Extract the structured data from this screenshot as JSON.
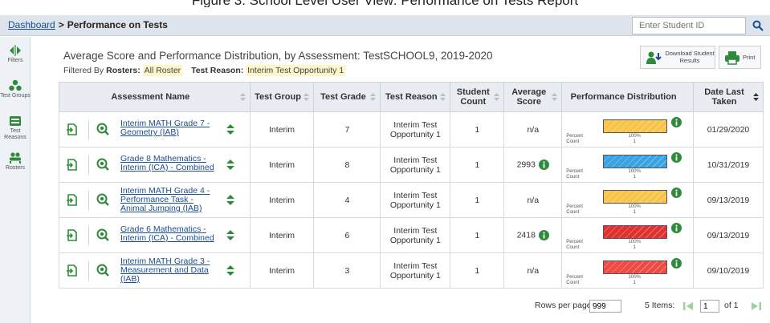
{
  "caption": "Figure 3. School Level User View: Performance on Tests Report",
  "breadcrumb": {
    "home": "Dashboard",
    "separator": ">",
    "current": "Performance on Tests"
  },
  "student_search": {
    "placeholder": "Enter Student ID",
    "icon": "search-icon"
  },
  "left_nav": [
    {
      "label": "Filters",
      "icon": "filters-icon"
    },
    {
      "label": "Test Groups",
      "icon": "test-groups-icon"
    },
    {
      "label": "Test Reasons",
      "icon": "test-reasons-icon"
    },
    {
      "label": "Rosters",
      "icon": "rosters-icon"
    }
  ],
  "panel": {
    "title": "Average Score and Performance Distribution, by Assessment: TestSCHOOL9, 2019-2020",
    "filter_prefix": "Filtered By",
    "rosters_label": "Rosters:",
    "rosters_value": "All Roster",
    "reason_label": "Test Reason:",
    "reason_value": "Interim Test Opportunity 1"
  },
  "actions": {
    "download": "Download Student Results",
    "print": "Print"
  },
  "table": {
    "headers": [
      "Assessment Name",
      "Test Group",
      "Test Grade",
      "Test Reason",
      "Student Count",
      "Average Score",
      "Performance Distribution",
      "Date Last Taken"
    ],
    "perf_labels": {
      "percent": "Percent",
      "count": "Count"
    },
    "rows": [
      {
        "name": "Interim MATH Grade 7 - Geometry (IAB)",
        "group": "Interim",
        "grade": "7",
        "reason": "Interim Test Opportunity 1",
        "count": "1",
        "score": "n/a",
        "score_info": false,
        "percent": "100%",
        "pcount": "1",
        "bar_color": "#f7c448",
        "date": "01/29/2020"
      },
      {
        "name": "Grade 8 Mathematics - Interim (ICA) - Combined",
        "group": "Interim",
        "grade": "8",
        "reason": "Interim Test Opportunity 1",
        "count": "1",
        "score": "2993",
        "score_info": true,
        "percent": "100%",
        "pcount": "1",
        "bar_color": "#3aa3e3",
        "date": "10/31/2019"
      },
      {
        "name": "Interim MATH Grade 4 - Performance Task - Animal Jumping (IAB)",
        "group": "Interim",
        "grade": "4",
        "reason": "Interim Test Opportunity 1",
        "count": "1",
        "score": "n/a",
        "score_info": false,
        "percent": "100%",
        "pcount": "1",
        "bar_color": "#f7c448",
        "date": "09/13/2019"
      },
      {
        "name": "Grade 6 Mathematics - Interim (ICA) - Combined",
        "group": "Interim",
        "grade": "6",
        "reason": "Interim Test Opportunity 1",
        "count": "1",
        "score": "2418",
        "score_info": true,
        "percent": "100%",
        "pcount": "1",
        "bar_color": "#e03131",
        "date": "09/13/2019"
      },
      {
        "name": "Interim MATH Grade 3 - Measurement and Data (IAB)",
        "group": "Interim",
        "grade": "3",
        "reason": "Interim Test Opportunity 1",
        "count": "1",
        "score": "n/a",
        "score_info": false,
        "percent": "100%",
        "pcount": "1",
        "bar_color": "#ef4a43",
        "date": "09/10/2019"
      }
    ]
  },
  "pager": {
    "rows_label": "Rows per page:",
    "rows_value": "999",
    "items": "5 Items:",
    "page_value": "1",
    "of": "of 1"
  },
  "colors": {
    "accent_green": "#2e8b3a",
    "link": "#1a4d8f",
    "nav_bg": "#eef1f5"
  }
}
